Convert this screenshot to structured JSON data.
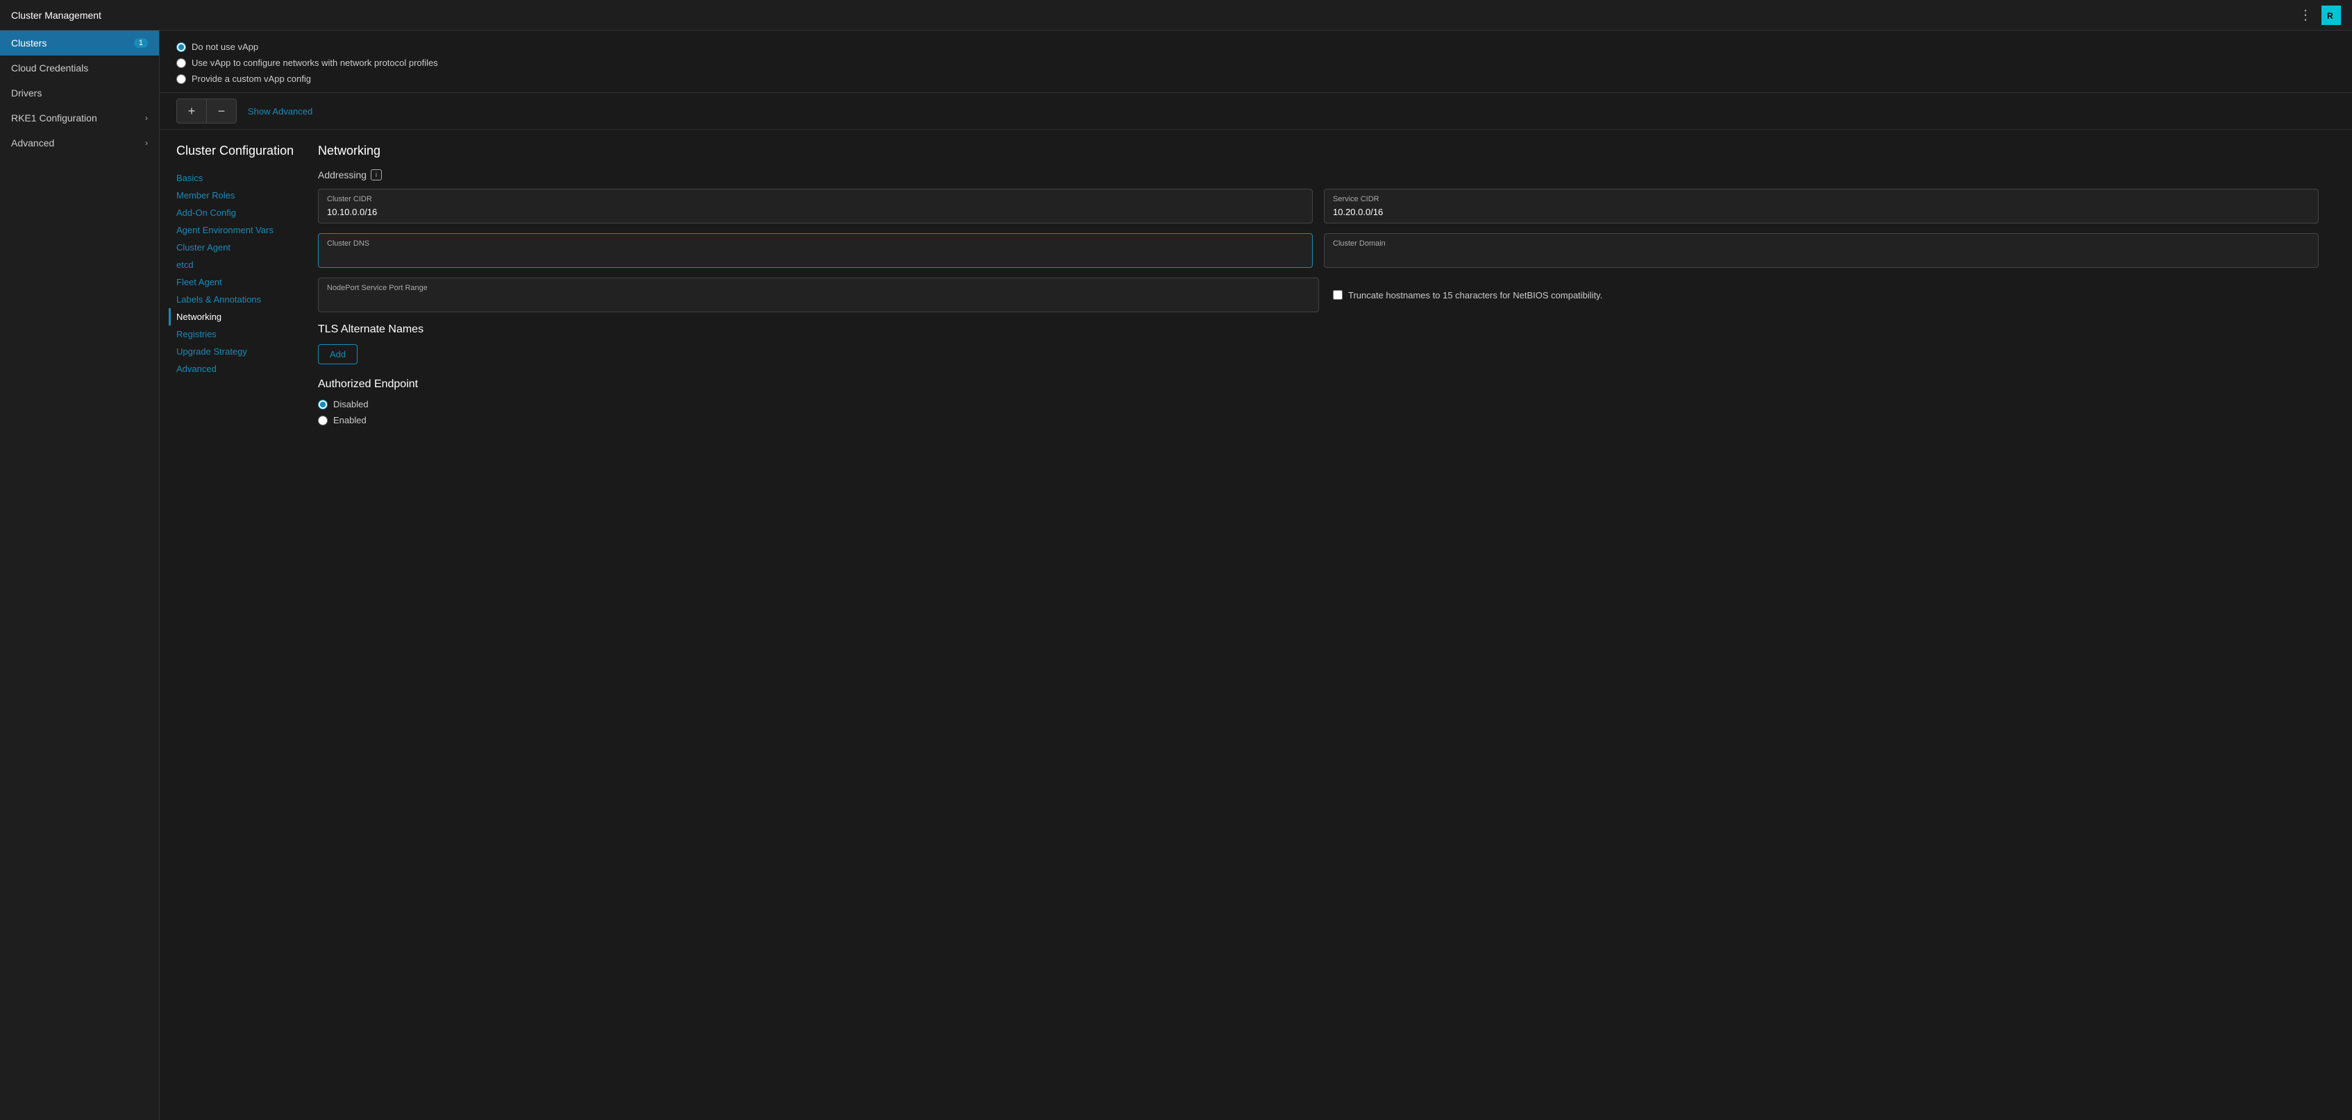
{
  "app": {
    "title": "Cluster Management",
    "logo_text": "R"
  },
  "sidebar": {
    "items": [
      {
        "id": "clusters",
        "label": "Clusters",
        "badge": "1",
        "active": true
      },
      {
        "id": "cloud-credentials",
        "label": "Cloud Credentials",
        "badge": null
      },
      {
        "id": "drivers",
        "label": "Drivers",
        "badge": null
      },
      {
        "id": "rke1-configuration",
        "label": "RKE1 Configuration",
        "chevron": true
      },
      {
        "id": "advanced",
        "label": "Advanced",
        "chevron": true
      }
    ]
  },
  "vapp": {
    "options": [
      {
        "id": "no-vapp",
        "label": "Do not use vApp",
        "checked": true
      },
      {
        "id": "vapp-networks",
        "label": "Use vApp to configure networks with network protocol profiles",
        "checked": false
      },
      {
        "id": "custom-vapp",
        "label": "Provide a custom vApp config",
        "checked": false
      }
    ]
  },
  "buttons": {
    "plus": "+",
    "minus": "−",
    "show_advanced": "Show Advanced"
  },
  "cluster_config": {
    "title": "Cluster Configuration",
    "left_nav": [
      {
        "id": "basics",
        "label": "Basics"
      },
      {
        "id": "member-roles",
        "label": "Member Roles"
      },
      {
        "id": "add-on-config",
        "label": "Add-On Config"
      },
      {
        "id": "agent-environment-vars",
        "label": "Agent Environment Vars"
      },
      {
        "id": "cluster-agent",
        "label": "Cluster Agent"
      },
      {
        "id": "etcd",
        "label": "etcd"
      },
      {
        "id": "fleet-agent",
        "label": "Fleet Agent"
      },
      {
        "id": "labels-annotations",
        "label": "Labels & Annotations"
      },
      {
        "id": "networking",
        "label": "Networking",
        "active": true
      },
      {
        "id": "registries",
        "label": "Registries"
      },
      {
        "id": "upgrade-strategy",
        "label": "Upgrade Strategy"
      },
      {
        "id": "advanced-nav",
        "label": "Advanced"
      }
    ]
  },
  "networking": {
    "title": "Networking",
    "addressing_label": "Addressing",
    "fields": {
      "cluster_cidr": {
        "label": "Cluster CIDR",
        "value": "10.10.0.0/16",
        "placeholder": ""
      },
      "service_cidr": {
        "label": "Service CIDR",
        "value": "10.20.0.0/16",
        "placeholder": ""
      },
      "cluster_dns": {
        "label": "Cluster DNS",
        "value": "",
        "placeholder": "",
        "focused": true
      },
      "cluster_domain": {
        "label": "Cluster Domain",
        "value": "",
        "placeholder": ""
      },
      "nodeport_range": {
        "label": "NodePort Service Port Range",
        "value": "",
        "placeholder": ""
      }
    },
    "truncate_label": "Truncate hostnames to 15 characters for NetBIOS compatibility.",
    "tls": {
      "title": "TLS Alternate Names",
      "add_label": "Add"
    },
    "authorized_endpoint": {
      "title": "Authorized Endpoint",
      "options": [
        {
          "id": "disabled",
          "label": "Disabled",
          "checked": true
        },
        {
          "id": "enabled",
          "label": "Enabled",
          "checked": false
        }
      ]
    }
  }
}
